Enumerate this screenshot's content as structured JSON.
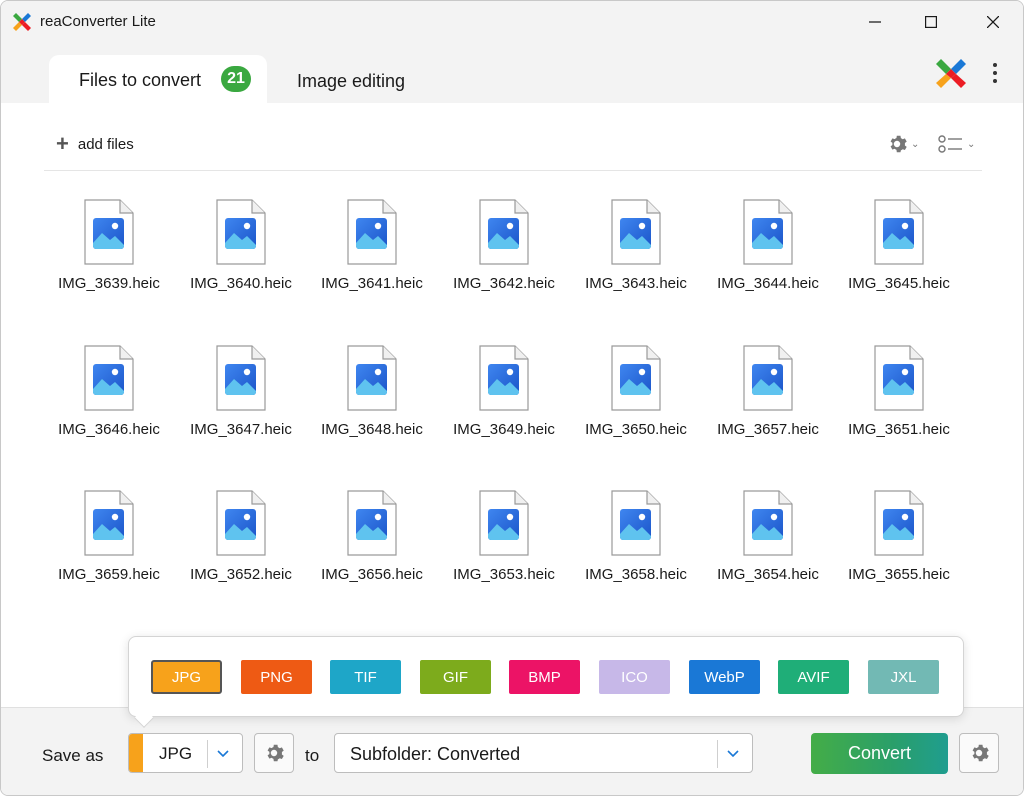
{
  "window": {
    "title": "reaConverter Lite",
    "controls": [
      "minimize",
      "maximize",
      "close"
    ]
  },
  "tabs": [
    {
      "label": "Files to convert",
      "badge": "21",
      "active": true
    },
    {
      "label": "Image editing",
      "active": false
    }
  ],
  "toolbar": {
    "add_files_label": "add files",
    "icons": [
      "plus-icon",
      "gear-icon",
      "list-view-icon"
    ]
  },
  "files": [
    "IMG_3639.heic",
    "IMG_3640.heic",
    "IMG_3641.heic",
    "IMG_3642.heic",
    "IMG_3643.heic",
    "IMG_3644.heic",
    "IMG_3645.heic",
    "IMG_3646.heic",
    "IMG_3647.heic",
    "IMG_3648.heic",
    "IMG_3649.heic",
    "IMG_3650.heic",
    "IMG_3657.heic",
    "IMG_3651.heic",
    "IMG_3659.heic",
    "IMG_3652.heic",
    "IMG_3656.heic",
    "IMG_3653.heic",
    "IMG_3658.heic",
    "IMG_3654.heic",
    "IMG_3655.heic"
  ],
  "formats": [
    {
      "label": "JPG",
      "color": "#f7a21b",
      "selected": true
    },
    {
      "label": "PNG",
      "color": "#ee5a14"
    },
    {
      "label": "TIF",
      "color": "#1ea6c8"
    },
    {
      "label": "GIF",
      "color": "#7dab1c"
    },
    {
      "label": "BMP",
      "color": "#ec1366"
    },
    {
      "label": "ICO",
      "color": "#c7b8e8"
    },
    {
      "label": "WebP",
      "color": "#1a78d6"
    },
    {
      "label": "AVIF",
      "color": "#1fae78"
    },
    {
      "label": "JXL",
      "color": "#72b9b4"
    }
  ],
  "bottom": {
    "save_as_label": "Save as",
    "format_value": "JPG",
    "to_label": "to",
    "destination_value": "Subfolder: Converted",
    "convert_label": "Convert"
  },
  "colors": {
    "accent_green": "#3aa840",
    "accent_orange": "#f7a21b",
    "link_blue": "#1a78d6"
  }
}
